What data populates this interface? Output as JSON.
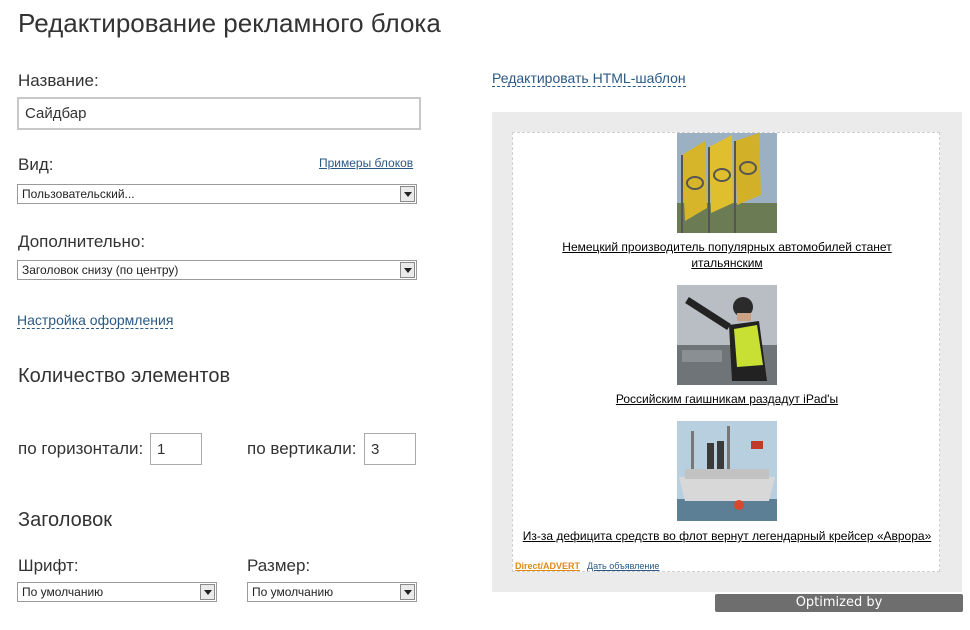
{
  "page": {
    "title": "Редактирование рекламного блока"
  },
  "form": {
    "name_label": "Название:",
    "name_value": "Сайдбар",
    "type_label": "Вид:",
    "examples_link": "Примеры блоков",
    "type_value": "Пользовательский...",
    "extra_label": "Дополнительно:",
    "extra_value": "Заголовок снизу (по центру)",
    "design_link": "Настройка оформления",
    "count_title": "Количество элементов",
    "horizontal_label": "по горизонтали:",
    "horizontal_value": "1",
    "vertical_label": "по вертикали:",
    "vertical_value": "3",
    "header_title": "Заголовок",
    "font_label": "Шрифт:",
    "font_value": "По умолчанию",
    "size_label": "Размер:",
    "size_value": "По умолчанию"
  },
  "preview": {
    "edit_html_link": "Редактировать HTML-шаблон",
    "ads": [
      {
        "text_line1": "Немецкий производитель популярных автомобилей станет",
        "text_line2": "итальянским"
      },
      {
        "text_line1": "Российским гаишникам раздадут iPad'ы",
        "text_line2": ""
      },
      {
        "text_line1": "Из-за дефицита средств во флот вернут легендарный крейсер «Аврора»",
        "text_line2": ""
      }
    ],
    "footer_direct": "Direct/ADVERT",
    "footer_link": "Дать объявление"
  },
  "watermark": "Optimized by www.ImageOptimizer.net"
}
